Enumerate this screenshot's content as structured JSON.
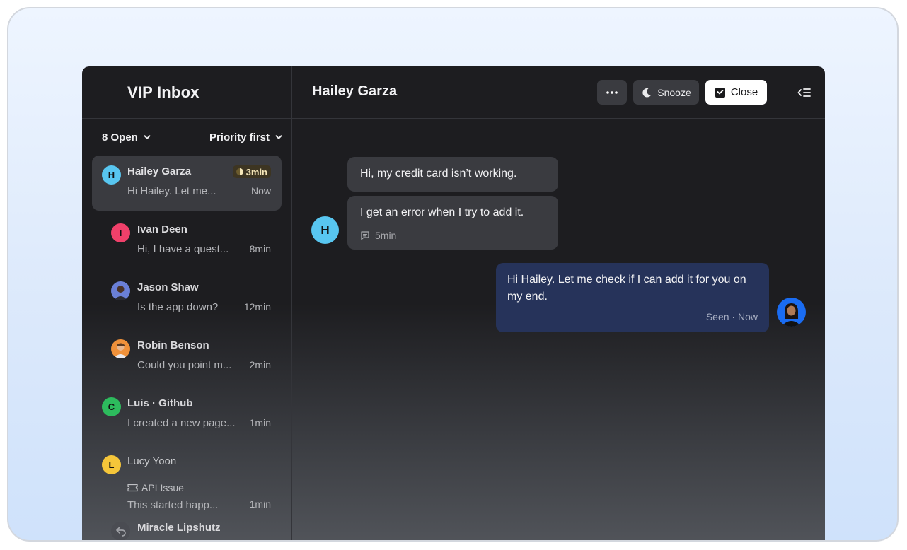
{
  "sidebar": {
    "title": "VIP Inbox",
    "filter_open": "8 Open",
    "filter_sort": "Priority first",
    "conversations": [
      {
        "initial": "H",
        "name": "Hailey Garza",
        "preview": "Hi Hailey. Let me...",
        "time": "Now",
        "badge": "3min",
        "color": "#58c6f0"
      },
      {
        "initial": "I",
        "name": "Ivan Deen",
        "preview": "Hi, I have a quest...",
        "time": "8min",
        "color": "#f0406a"
      },
      {
        "initial": "",
        "name": "Jason Shaw",
        "preview": "Is the app down?",
        "time": "12min",
        "color": "#6a7fd6"
      },
      {
        "initial": "",
        "name": "Robin Benson",
        "preview": "Could you point m...",
        "time": "2min",
        "color": "#f0913a"
      },
      {
        "initial": "C",
        "name": "Luis · Github",
        "preview": "I created a new page...",
        "time": "1min",
        "color": "#2dbb5d"
      },
      {
        "initial": "L",
        "name": "Lucy Yoon",
        "tag": "API Issue",
        "preview": "This started happ...",
        "time": "1min",
        "color": "#f5c63a"
      },
      {
        "initial": "",
        "name": "Miracle Lipshutz"
      }
    ]
  },
  "main": {
    "title": "Hailey Garza",
    "btn_snooze": "Snooze",
    "btn_close": "Close",
    "messages": [
      {
        "text": "Hi, my credit card isn’t working."
      },
      {
        "text": "I get an error when I try to add it.",
        "meta": "5min"
      },
      {
        "text": "Hi Hailey. Let me check if I can add it for you on my end.",
        "meta": "Seen · Now"
      }
    ],
    "avatar_initial": "H"
  }
}
